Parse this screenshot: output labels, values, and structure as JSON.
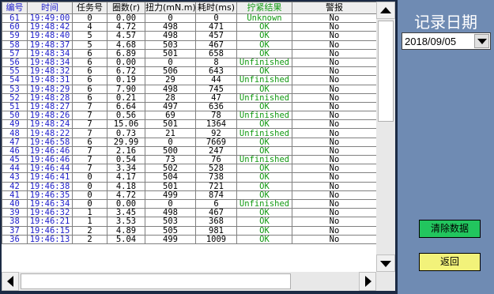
{
  "table": {
    "headers": [
      "编号",
      "时间",
      "任务号",
      "圈数(r)",
      "扭力(mN.m)",
      "耗时(ms)",
      "拧紧结果",
      "警报"
    ],
    "rows": [
      [
        "61",
        "19:49:00",
        "0",
        "0.00",
        "0",
        "0",
        "Unknown",
        "No"
      ],
      [
        "60",
        "19:48:42",
        "4",
        "4.72",
        "498",
        "471",
        "OK",
        "No"
      ],
      [
        "59",
        "19:48:40",
        "5",
        "4.57",
        "498",
        "457",
        "OK",
        "No"
      ],
      [
        "58",
        "19:48:37",
        "5",
        "4.68",
        "503",
        "467",
        "OK",
        "No"
      ],
      [
        "57",
        "19:48:34",
        "6",
        "6.89",
        "501",
        "658",
        "OK",
        "No"
      ],
      [
        "56",
        "19:48:34",
        "6",
        "0.00",
        "0",
        "8",
        "Unfinished",
        "No"
      ],
      [
        "55",
        "19:48:32",
        "6",
        "6.72",
        "506",
        "643",
        "OK",
        "No"
      ],
      [
        "54",
        "19:48:31",
        "6",
        "0.19",
        "29",
        "44",
        "Unfinished",
        "No"
      ],
      [
        "53",
        "19:48:29",
        "6",
        "7.90",
        "498",
        "745",
        "OK",
        "No"
      ],
      [
        "52",
        "19:48:28",
        "6",
        "0.21",
        "28",
        "47",
        "Unfinished",
        "No"
      ],
      [
        "51",
        "19:48:27",
        "7",
        "6.64",
        "497",
        "636",
        "OK",
        "No"
      ],
      [
        "50",
        "19:48:26",
        "7",
        "0.56",
        "69",
        "78",
        "Unfinished",
        "No"
      ],
      [
        "49",
        "19:48:24",
        "7",
        "15.06",
        "501",
        "1364",
        "OK",
        "No"
      ],
      [
        "48",
        "19:48:22",
        "7",
        "0.73",
        "21",
        "92",
        "Unfinished",
        "No"
      ],
      [
        "47",
        "19:46:58",
        "6",
        "29.99",
        "0",
        "7669",
        "OK",
        "No"
      ],
      [
        "46",
        "19:46:46",
        "7",
        "2.16",
        "500",
        "247",
        "OK",
        "No"
      ],
      [
        "45",
        "19:46:46",
        "7",
        "0.54",
        "73",
        "76",
        "Unfinished",
        "No"
      ],
      [
        "44",
        "19:46:44",
        "7",
        "3.34",
        "502",
        "528",
        "OK",
        "No"
      ],
      [
        "43",
        "19:46:41",
        "0",
        "4.17",
        "504",
        "738",
        "OK",
        "No"
      ],
      [
        "42",
        "19:46:38",
        "0",
        "4.18",
        "501",
        "721",
        "OK",
        "No"
      ],
      [
        "41",
        "19:46:35",
        "0",
        "4.72",
        "499",
        "874",
        "OK",
        "No"
      ],
      [
        "40",
        "19:46:34",
        "0",
        "0.00",
        "0",
        "6",
        "Unfinished",
        "No"
      ],
      [
        "39",
        "19:46:32",
        "1",
        "3.45",
        "498",
        "467",
        "OK",
        "No"
      ],
      [
        "38",
        "19:46:21",
        "1",
        "3.53",
        "503",
        "368",
        "OK",
        "No"
      ],
      [
        "37",
        "19:46:15",
        "2",
        "4.89",
        "505",
        "981",
        "OK",
        "No"
      ],
      [
        "36",
        "19:46:13",
        "2",
        "5.04",
        "499",
        "1009",
        "OK",
        "No"
      ]
    ]
  },
  "side": {
    "title": "记录日期",
    "date_value": "2018/09/05",
    "clear_label": "清除数据",
    "back_label": "返回"
  },
  "icons": {
    "scroll_up": "arrow-up-icon",
    "scroll_down": "arrow-down-icon",
    "scroll_left": "arrow-left-icon",
    "scroll_right": "arrow-right-icon",
    "dropdown": "chevron-down-icon"
  },
  "colors": {
    "background": "#6f8bb3",
    "id_time_text": "#2222cc",
    "result_text": "#119911",
    "clear_button": "#22c55e",
    "back_button": "#f2f27a"
  }
}
